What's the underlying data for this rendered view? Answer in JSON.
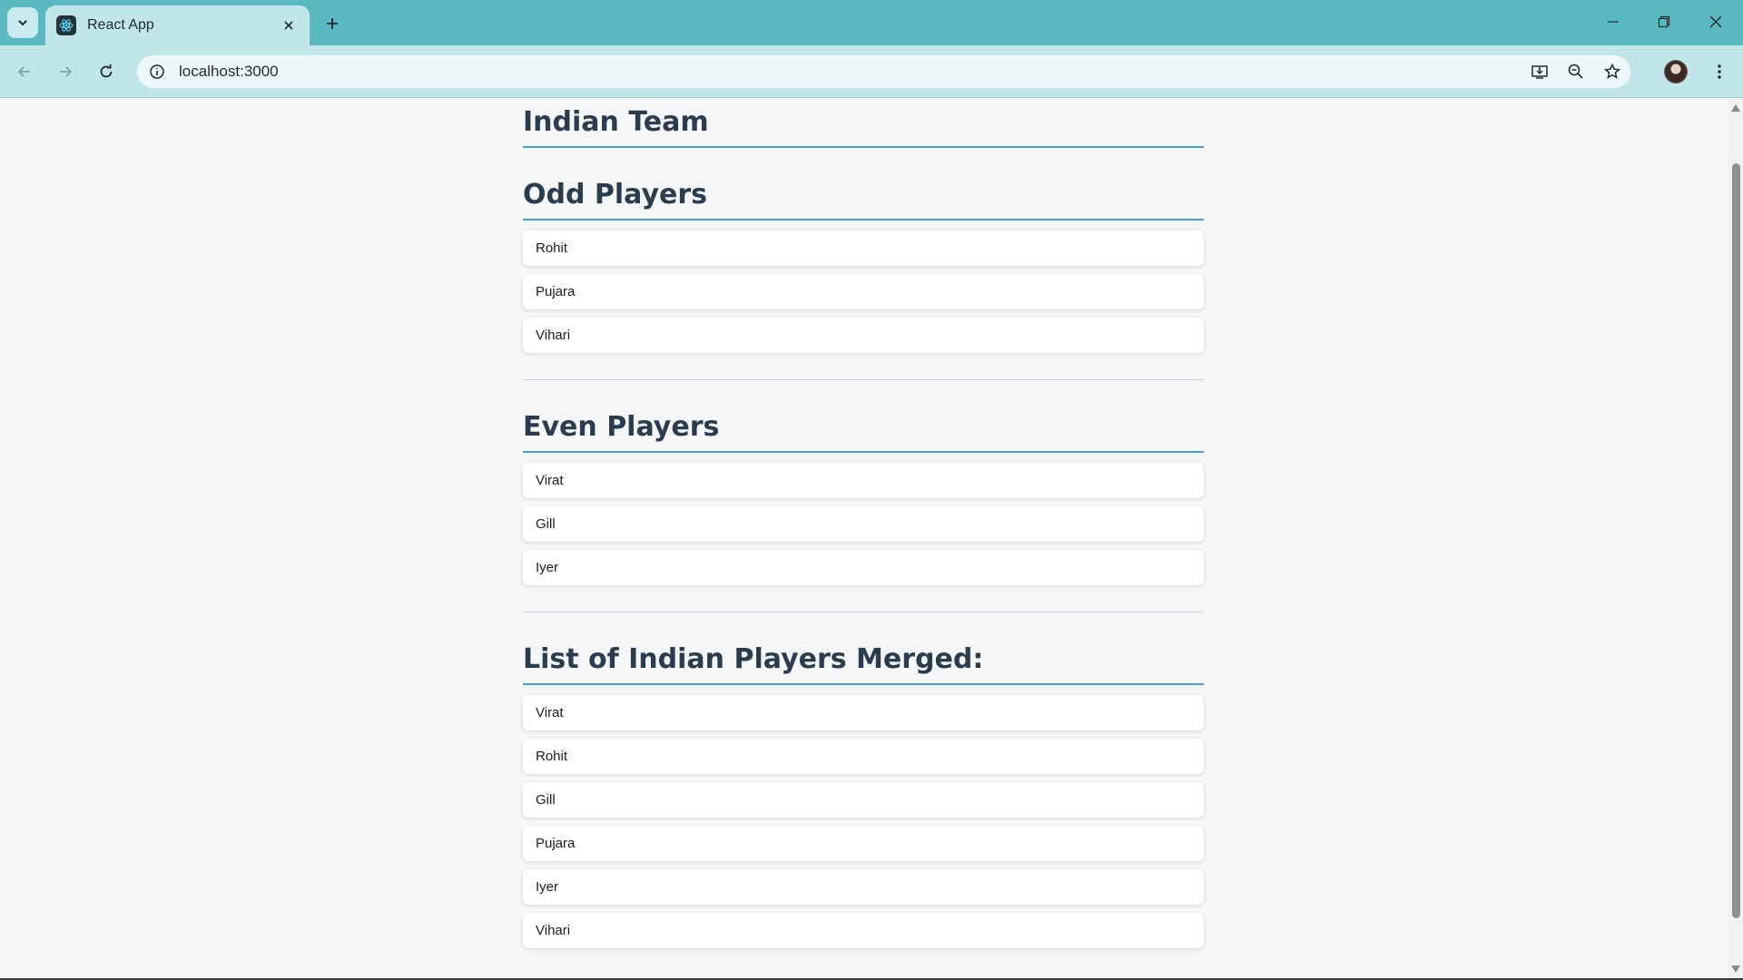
{
  "browser": {
    "tab_title": "React App",
    "url": "localhost:3000"
  },
  "page": {
    "team_title": "Indian Team",
    "sections": [
      {
        "title": "Odd Players",
        "players": [
          "Rohit",
          "Pujara",
          "Vihari"
        ]
      },
      {
        "title": "Even Players",
        "players": [
          "Virat",
          "Gill",
          "Iyer"
        ]
      },
      {
        "title": "List of Indian Players Merged:",
        "players": [
          "Virat",
          "Rohit",
          "Gill",
          "Pujara",
          "Iyer",
          "Vihari"
        ]
      }
    ]
  },
  "colors": {
    "tabstrip": "#5ab8c1",
    "toolbar": "#c1e6ea",
    "heading_text": "#2b3c4f",
    "heading_rule": "#4a9fc8",
    "page_bg": "#f4f6f7"
  }
}
